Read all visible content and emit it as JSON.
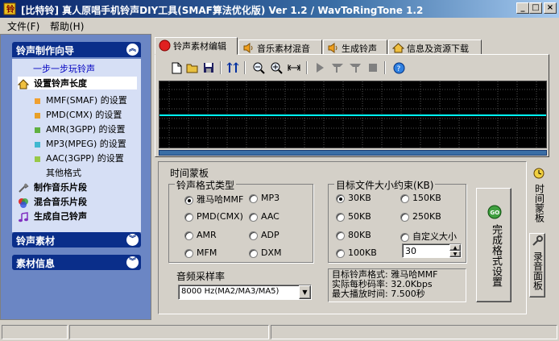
{
  "window": {
    "title": "[比特铃] 真人原唱手机铃声DIY工具(SMAF算法优化版) Ver 1.2  / WavToRingTone 1.2",
    "min_label": "_",
    "max_label": "□",
    "close_label": "×"
  },
  "menu": {
    "file": "文件(F)",
    "help": "帮助(H)"
  },
  "sidebar": {
    "group1_title": "铃声制作向导",
    "step_link": "一步一步玩铃声",
    "items": [
      {
        "label": "设置铃声长度",
        "icon": "home-icon"
      },
      {
        "label": "MMF(SMAF) 的设置",
        "color": "#f0a030"
      },
      {
        "label": "PMD(CMX)  的设置",
        "color": "#e8a028"
      },
      {
        "label": "AMR(3GPP) 的设置",
        "color": "#60b040"
      },
      {
        "label": "MP3(MPEG) 的设置",
        "color": "#40b8d0"
      },
      {
        "label": "AAC(3GPP) 的设置",
        "color": "#98c848"
      },
      {
        "label": "其他格式"
      },
      {
        "label": "制作音乐片段",
        "icon": "wrench-icon"
      },
      {
        "label": "混合音乐片段",
        "icon": "mix-icon"
      },
      {
        "label": "生成自己铃声",
        "icon": "music-note-icon"
      }
    ],
    "group2_title": "铃声素材",
    "group3_title": "素材信息"
  },
  "tabs": [
    {
      "label": "铃声素材编辑",
      "icon": "record-icon",
      "active": true
    },
    {
      "label": "音乐素材混音",
      "icon": "speaker-icon",
      "active": false
    },
    {
      "label": "生成铃声",
      "icon": "speaker-icon",
      "active": false
    },
    {
      "label": "信息及资源下载",
      "icon": "home-icon",
      "active": false
    }
  ],
  "toolbar": {
    "buttons": [
      "new-icon",
      "open-icon",
      "save-icon",
      "split-icon",
      "zoom-out-icon",
      "zoom-in-icon",
      "fit-icon",
      "play-icon",
      "mark-in-icon",
      "mark-out-icon",
      "stop-icon",
      "info-icon"
    ]
  },
  "panel": {
    "group_title": "时间蒙板",
    "format_group": "铃声格式类型",
    "formats": [
      {
        "label": "雅马哈MMF",
        "selected": true
      },
      {
        "label": "MP3",
        "selected": false
      },
      {
        "label": "PMD(CMX)",
        "selected": false
      },
      {
        "label": "AAC",
        "selected": false
      },
      {
        "label": "AMR",
        "selected": false
      },
      {
        "label": "ADP",
        "selected": false
      },
      {
        "label": "MFM",
        "selected": false
      },
      {
        "label": "DXM",
        "selected": false
      }
    ],
    "sample_rate_label": "音频采样率",
    "sample_rate_value": "8000 Hz(MA2/MA3/MA5)",
    "size_group": "目标文件大小约束(KB)",
    "sizes": [
      {
        "label": "30KB",
        "selected": true
      },
      {
        "label": "150KB",
        "selected": false
      },
      {
        "label": "50KB",
        "selected": false
      },
      {
        "label": "250KB",
        "selected": false
      },
      {
        "label": "80KB",
        "selected": false
      },
      {
        "label": "自定义大小",
        "selected": false
      },
      {
        "label": "100KB",
        "selected": false
      }
    ],
    "custom_size_value": "30",
    "info_lines": [
      "目标铃声格式: 雅马哈MMF",
      "实际每秒码率: 32.0Kbps",
      "最大播放时间: 7.500秒"
    ],
    "finish_button": "完成格式设置",
    "finish_icon_text": "GO"
  },
  "side_tabs": {
    "time_mask": "时间蒙板",
    "record_panel": "录音面板"
  },
  "colors": {
    "wave_line": "#00ffff",
    "wave_grid": "#505050",
    "nav_header": "#0a2e8a",
    "panel_bg": "#6b86c4"
  }
}
